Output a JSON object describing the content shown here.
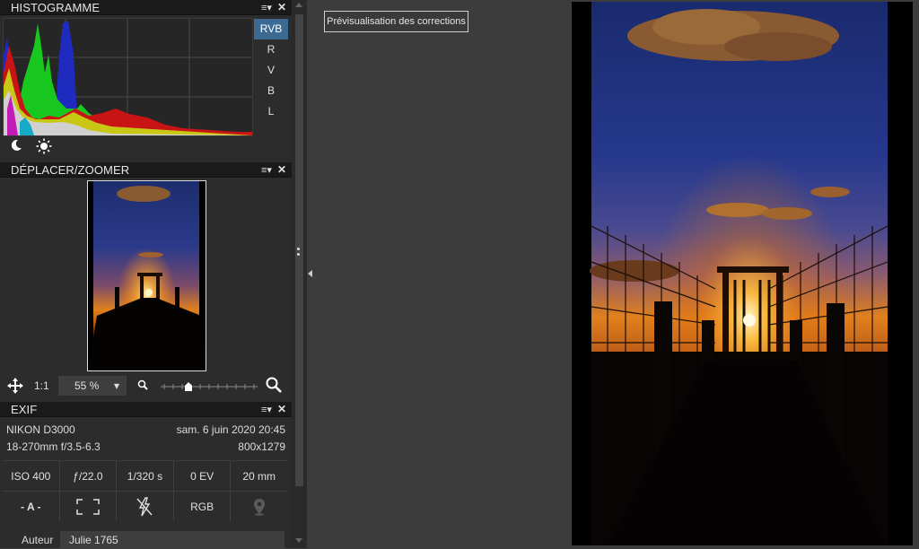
{
  "histogram": {
    "title": "HISTOGRAMME",
    "menu_icon": "≡▾",
    "close_icon": "✕",
    "channels": [
      "RVB",
      "R",
      "V",
      "B",
      "L"
    ],
    "active_channel": "RVB",
    "tools": [
      "moon-icon",
      "sun-icon"
    ]
  },
  "navigator": {
    "title": "DÉPLACER/ZOOMER",
    "menu_icon": "≡▾",
    "close_icon": "✕",
    "one_to_one": "1:1",
    "zoom_value": "55 %",
    "zoom_arrow": "▾",
    "slider_position": 0.27
  },
  "exif": {
    "title": "EXIF",
    "menu_icon": "≡▾",
    "close_icon": "✕",
    "camera": "NIKON D3000",
    "date": "sam. 6 juin 2020 20:45",
    "lens": "18-270mm f/3.5-6.3",
    "dimensions": "800x1279",
    "settings": [
      "ISO 400",
      "ƒ/22.0",
      "1/320 s",
      "0 EV",
      "20 mm"
    ],
    "mode": "- A -",
    "color_space": "RGB",
    "icons": [
      "metering-frame-icon",
      "flash-off-icon",
      "location-pin-icon"
    ],
    "author_label": "Auteur",
    "author_value": "Julie 1765"
  },
  "main": {
    "preview_button": "Prévisualisation des corrections"
  },
  "colors": {
    "accent": "#3d6a93",
    "panel_bg": "#2c2c2c",
    "header_bg": "#1a1a1a",
    "workspace_bg": "#3c3c3c"
  }
}
